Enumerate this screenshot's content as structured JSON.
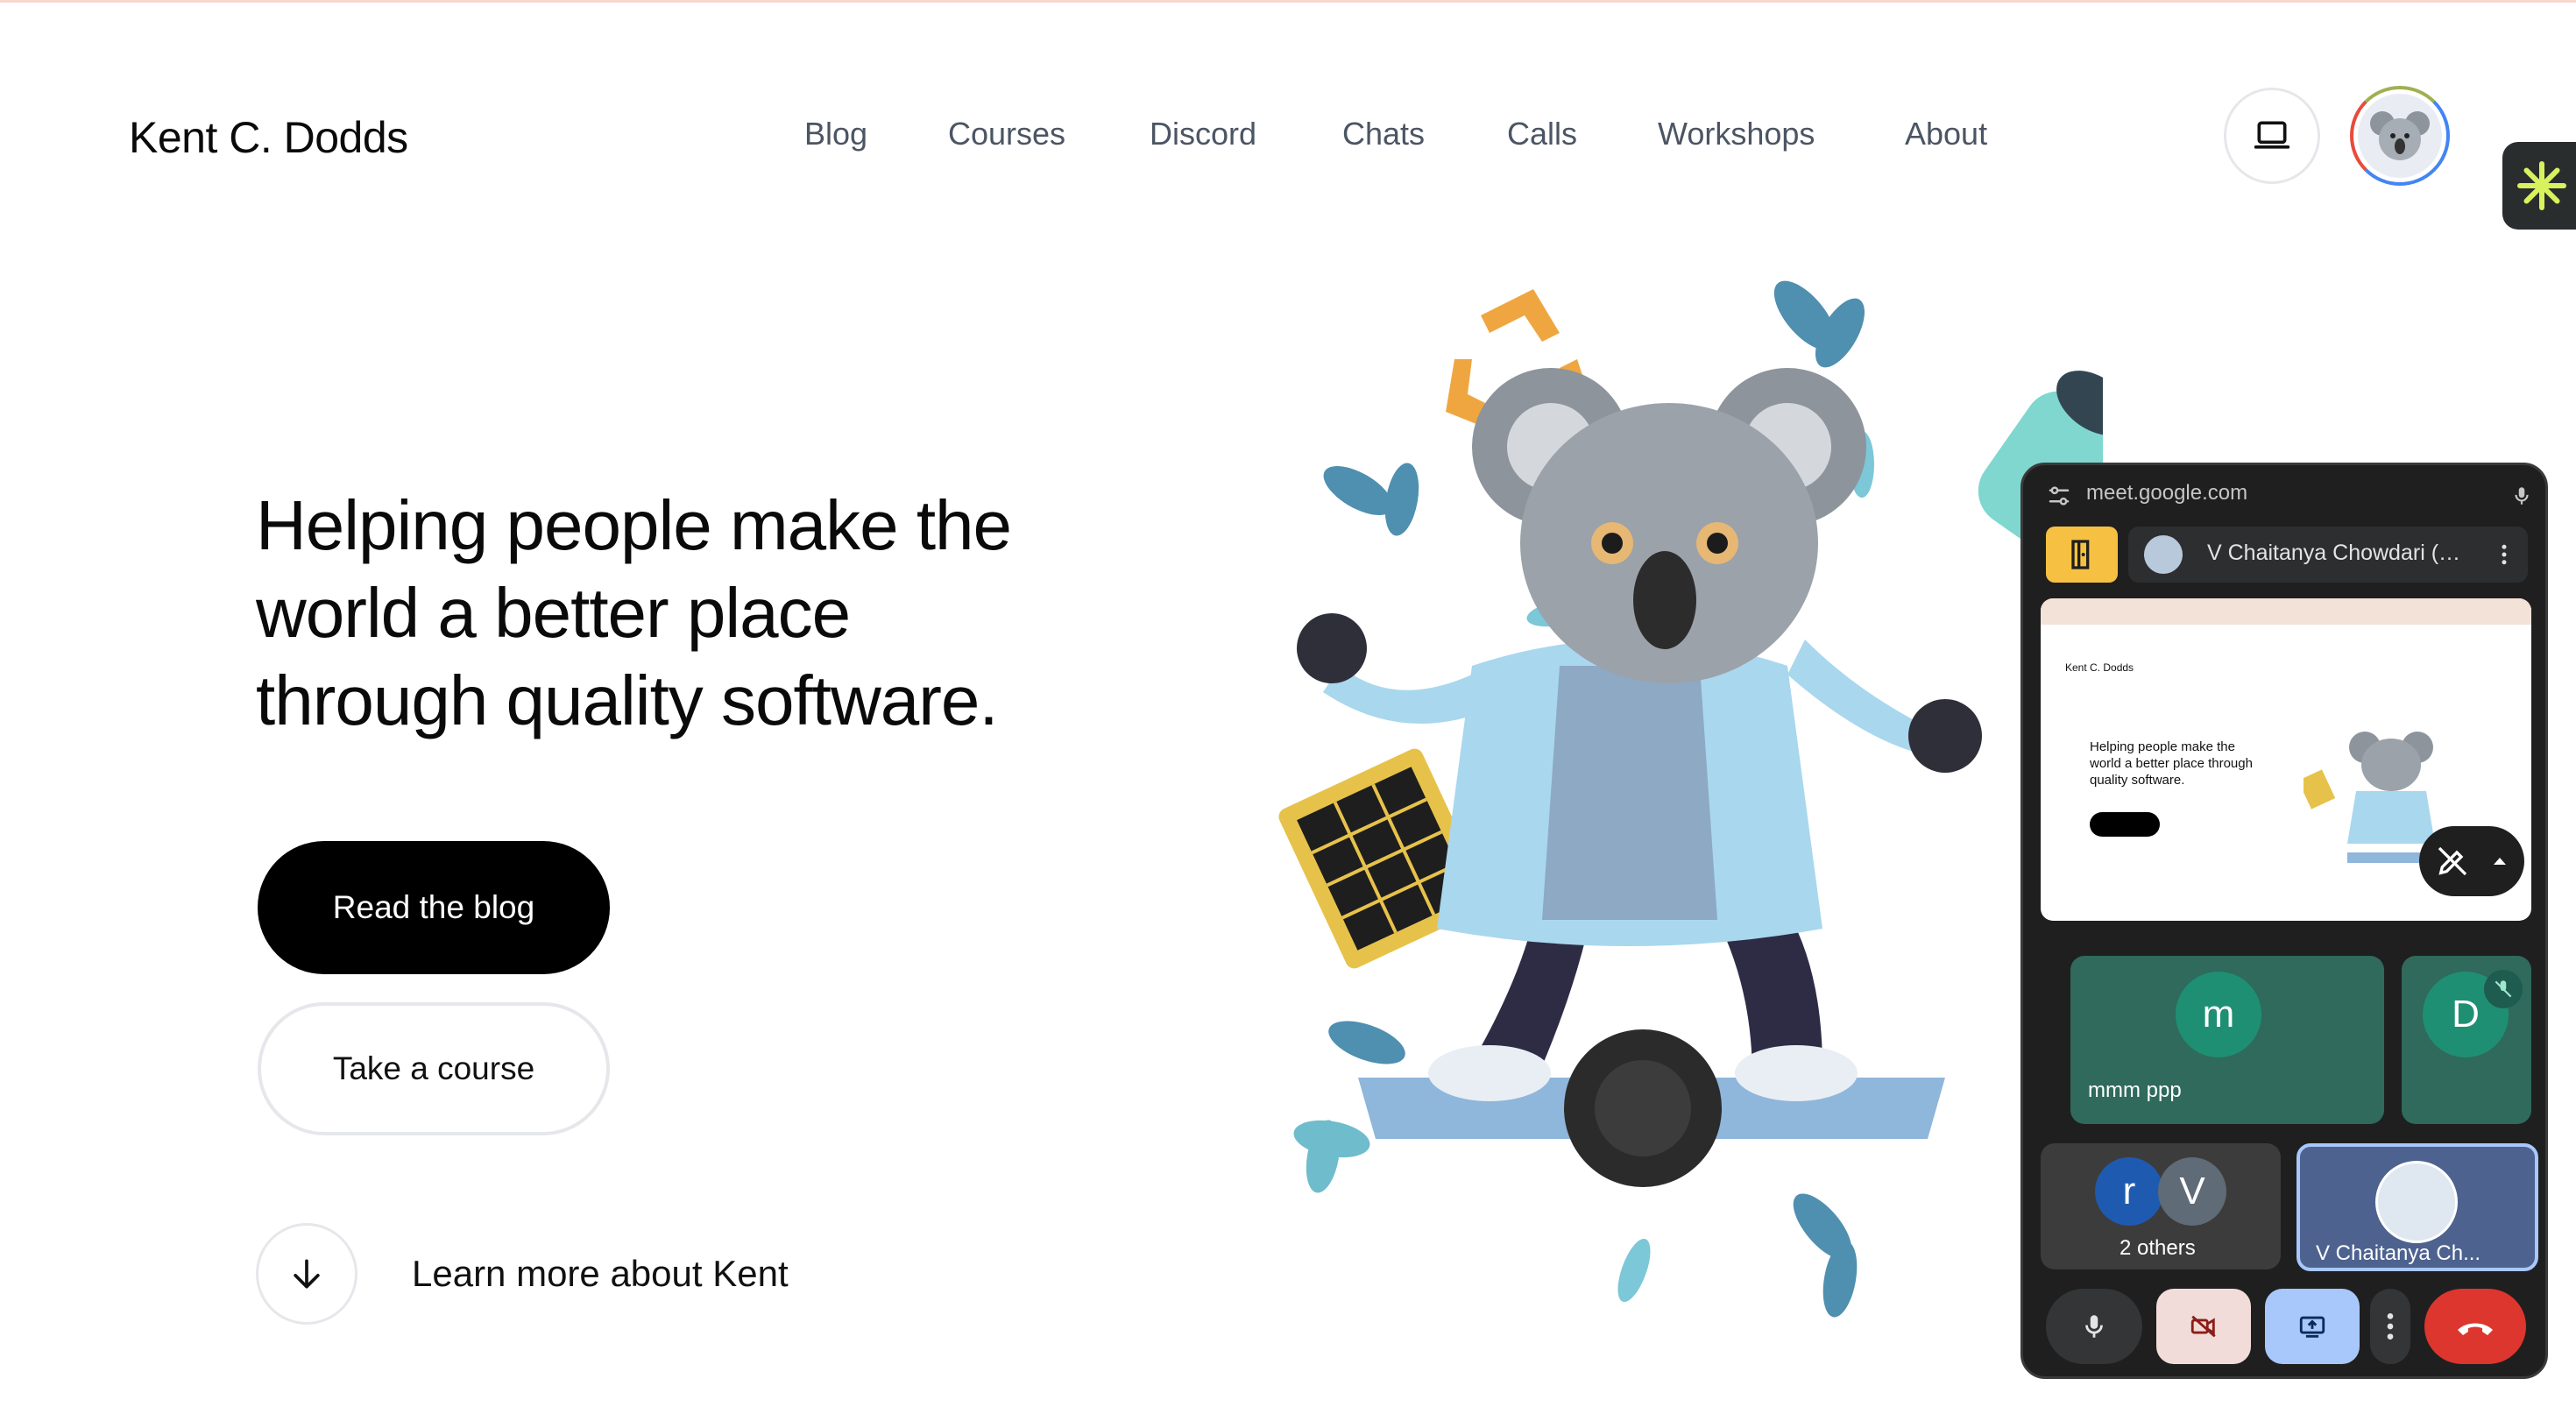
{
  "site": {
    "title": "Kent C. Dodds",
    "nav": [
      "Blog",
      "Courses",
      "Discord",
      "Chats",
      "Calls",
      "Workshops",
      "About"
    ]
  },
  "hero": {
    "headline_lines": [
      "Helping people make the",
      "world a better place",
      "through quality software."
    ],
    "primary_cta": "Read the blog",
    "secondary_cta": "Take a course",
    "learn_more": "Learn more about Kent"
  },
  "meet": {
    "url": "meet.google.com",
    "presenter": "V Chaitanya Chowdari (Yo...",
    "mini_headline": "Helping people make the world a better place through quality software.",
    "mini_site_title": "Kent C. Dodds",
    "participants": [
      {
        "initial": "m",
        "name": "mmm ppp",
        "color": "#2f6a5c"
      },
      {
        "initial": "D",
        "name": "",
        "color": "#2f6a5c"
      }
    ],
    "others": {
      "initials": [
        "r",
        "V"
      ],
      "label": "2 others"
    },
    "self_name": "V Chaitanya Ch...",
    "colors": {
      "accent_yellow": "#f6c142",
      "end_call": "#dc362e",
      "share": "#a8c7fa",
      "camera_off": "#f2dcd9"
    }
  }
}
